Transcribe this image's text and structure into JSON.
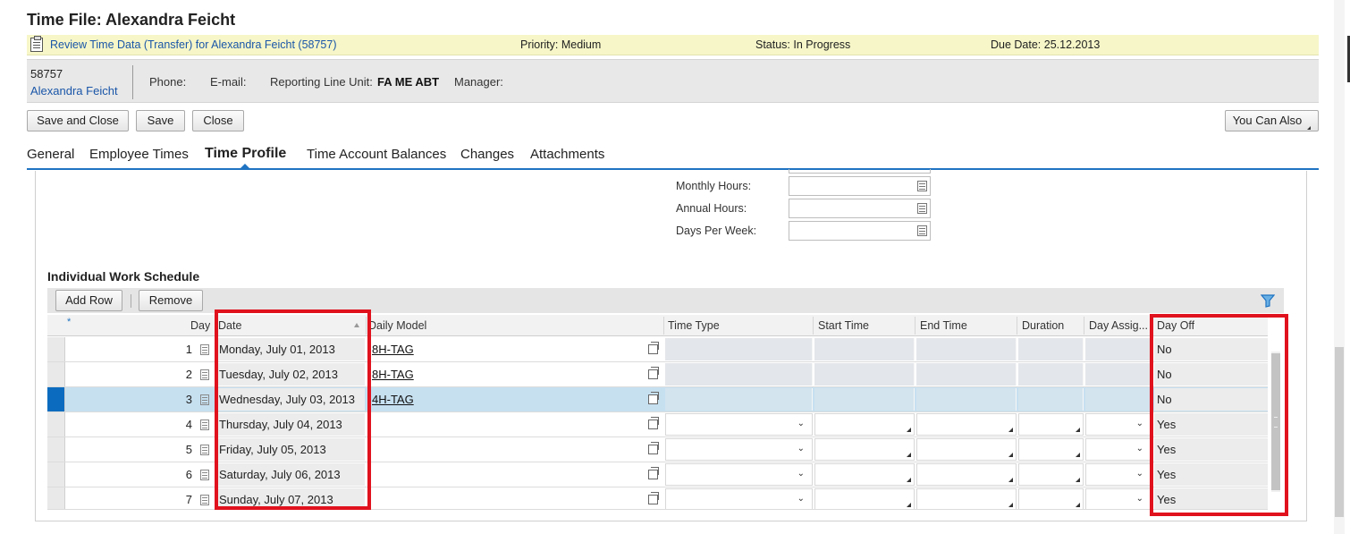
{
  "page_title": "Time File: Alexandra Feicht",
  "task": {
    "link": "Review Time Data (Transfer) for Alexandra Feicht (58757)",
    "priority": "Priority: Medium",
    "status": "Status: In Progress",
    "due_date": "Due Date: 25.12.2013"
  },
  "employee": {
    "id": "58757",
    "name": "Alexandra Feicht",
    "phone_label": "Phone:",
    "email_label": "E-mail:",
    "unit_label": "Reporting Line Unit:",
    "unit_value": "FA ME ABT",
    "manager_label": "Manager:"
  },
  "toolbar": {
    "save_close": "Save and Close",
    "save": "Save",
    "close": "Close",
    "you_can_also": "You Can Also"
  },
  "tabs": [
    {
      "label": "General"
    },
    {
      "label": "Employee Times"
    },
    {
      "label": "Time Profile",
      "active": true
    },
    {
      "label": "Time Account Balances"
    },
    {
      "label": "Changes"
    },
    {
      "label": "Attachments"
    }
  ],
  "form": {
    "monthly_hours": "Monthly Hours:",
    "annual_hours": "Annual Hours:",
    "days_per_week": "Days Per Week:"
  },
  "schedule": {
    "title": "Individual Work Schedule",
    "add_row": "Add Row",
    "remove": "Remove",
    "columns": {
      "required_marker": "*",
      "day": "Day",
      "date": "Date",
      "daily_model": "Daily Model",
      "time_type": "Time Type",
      "start_time": "Start Time",
      "end_time": "End Time",
      "duration": "Duration",
      "day_assignment": "Day Assig...",
      "day_off": "Day Off"
    },
    "rows": [
      {
        "day": "1",
        "date": "Monday, July 01, 2013",
        "daily_model": "8H-TAG",
        "day_off": "No"
      },
      {
        "day": "2",
        "date": "Tuesday, July 02, 2013",
        "daily_model": "8H-TAG",
        "day_off": "No"
      },
      {
        "day": "3",
        "date": "Wednesday, July 03, 2013",
        "daily_model": "4H-TAG",
        "day_off": "No",
        "selected": true
      },
      {
        "day": "4",
        "date": "Thursday, July 04, 2013",
        "daily_model": "",
        "day_off": "Yes"
      },
      {
        "day": "5",
        "date": "Friday, July 05, 2013",
        "daily_model": "",
        "day_off": "Yes"
      },
      {
        "day": "6",
        "date": "Saturday, July 06, 2013",
        "daily_model": "",
        "day_off": "Yes"
      },
      {
        "day": "7",
        "date": "Sunday, July 07, 2013",
        "daily_model": "",
        "day_off": "Yes"
      }
    ]
  },
  "colors": {
    "accent": "#1f73c2",
    "highlight_box": "#e0121d",
    "task_bar": "#f6f6c8",
    "selected_row": "#c6e0f0"
  }
}
